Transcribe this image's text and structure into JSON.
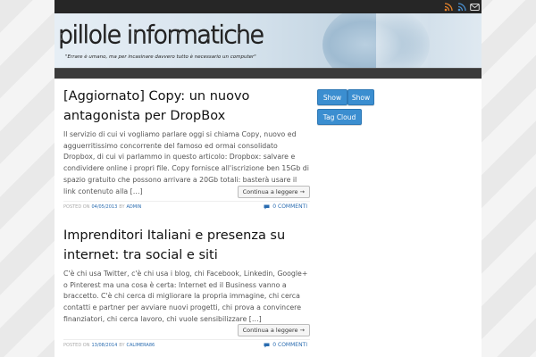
{
  "header": {
    "logo_text": "pillole informatiche",
    "tagline": "\"Errare è umano, ma per incasinare davvero tutto è necessario un computer\""
  },
  "topbar": {
    "icons": [
      "rss-orange-icon",
      "rss-blue-icon",
      "mail-icon"
    ]
  },
  "posts": [
    {
      "title": "[Aggiornato] Copy: un nuovo antagonista per DropBox",
      "excerpt": "Il servizio di cui vi vogliamo parlare oggi si chiama Copy, nuovo ed agguerritissimo concorrente del famoso ed ormai consolidato Dropbox, di cui vi parlammo in questo articolo: Dropbox: salvare e condividere online i propri file. Copy fornisce all'iscrizione ben 15Gb di spazio gratuito che possono arrivare a 20Gb totali: basterà usare il link contenuto alla […]",
      "more_label": "Continua a leggere →",
      "posted_on_label": "POSTED ON",
      "date": "04/05/2013",
      "by_label": "BY",
      "author": "ADMIN",
      "comments": "0 COMMENTI"
    },
    {
      "title": "Imprenditori Italiani e presenza su internet: tra social e siti",
      "excerpt": "C'è chi usa Twitter, c'è chi usa i blog, chi Facebook, Linkedin, Google+ o Pinterest ma una cosa è certa: Internet ed il Business vanno a braccetto. C'è chi cerca di migliorare la propria immagine, chi cerca contatti e partner per avviare nuovi progetti, chi prova a convincere finanziatori, chi cerca lavoro, chi vuole sensibilizzare […]",
      "more_label": "Continua a leggere →",
      "posted_on_label": "POSTED ON",
      "date": "13/08/2014",
      "by_label": "BY",
      "author": "CALIMERA86",
      "comments": "0 COMMENTI"
    }
  ],
  "sidebar": {
    "buttons": [
      "Show",
      "Show",
      "Tag Cloud"
    ]
  },
  "colors": {
    "accent": "#3b8ed0",
    "link": "#2a6cb0",
    "topbar": "#262626"
  }
}
